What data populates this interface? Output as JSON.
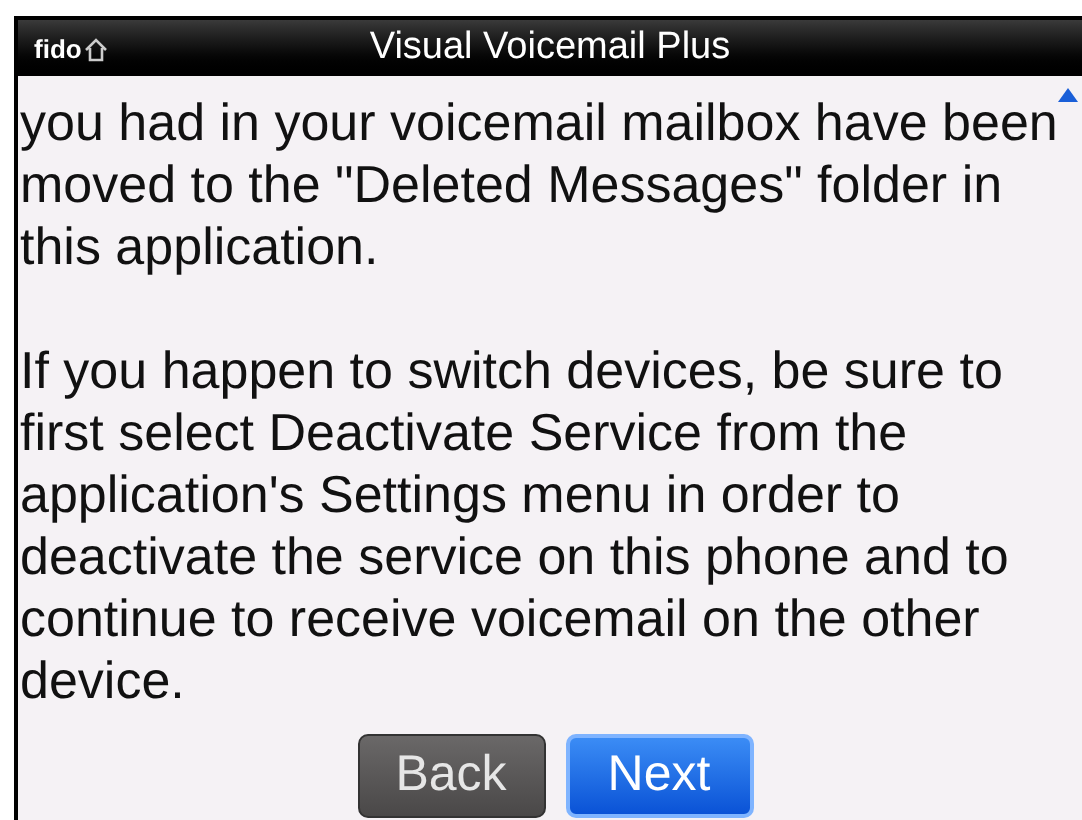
{
  "status_bar": {
    "carrier": "fido"
  },
  "window": {
    "title": "Visual Voicemail Plus"
  },
  "paragraphs": [
    "you had in your voicemail mailbox have been moved to the \"Deleted Messages\" folder in this application.",
    "If you happen to switch devices, be sure to first select Deactivate Service from the application's Settings menu in order to deactivate the service on this phone and to continue to receive voicemail on the other device."
  ],
  "buttons": [
    {
      "label": "Back",
      "selected": false
    },
    {
      "label": "Next",
      "selected": true
    }
  ]
}
